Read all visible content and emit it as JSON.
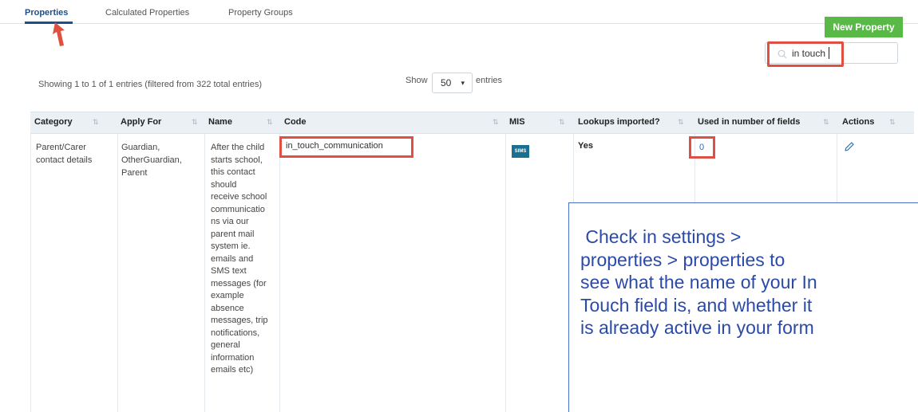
{
  "tabs": [
    {
      "label": "Properties",
      "active": true
    },
    {
      "label": "Calculated Properties",
      "active": false
    },
    {
      "label": "Property Groups",
      "active": false
    }
  ],
  "new_property_label": "New Property",
  "search": {
    "value": "in touch",
    "icon": "search-icon"
  },
  "info_text": "Showing 1 to 1 of 1 entries (filtered from 322 total entries)",
  "page_length": {
    "show_label": "Show",
    "value": "50",
    "entries_label": "entries"
  },
  "columns": [
    "Category",
    "Apply For",
    "Name",
    "Code",
    "MIS",
    "Lookups imported?",
    "Used in number of fields",
    "Actions"
  ],
  "row": {
    "category": "Parent/Carer\ncontact details",
    "apply_for": "Guardian,\nOtherGuardian,\nParent",
    "name": "After the child\nstarts school,\nthis contact\nshould\nreceive school\ncommunicatio\nns via our\nparent mail\nsystem ie.\nemails and\nSMS text\nmessages (for\nexample\nabsence\nmessages, trip\nnotifications,\ngeneral\ninformation\nemails etc)",
    "code": "in_touch_communication",
    "mis": "SIMS",
    "lookups_imported": "Yes",
    "used_in_fields": "0",
    "action_icon": "pencil-icon"
  },
  "callout": " Check in settings >\nproperties > properties to\nsee what the name of your In\nTouch field is, and whether it\nis already active in your form",
  "colors": {
    "accent": "#1f4e8c",
    "green": "#58b947",
    "highlight": "#e04f44",
    "callout": "#2b4aa8"
  }
}
